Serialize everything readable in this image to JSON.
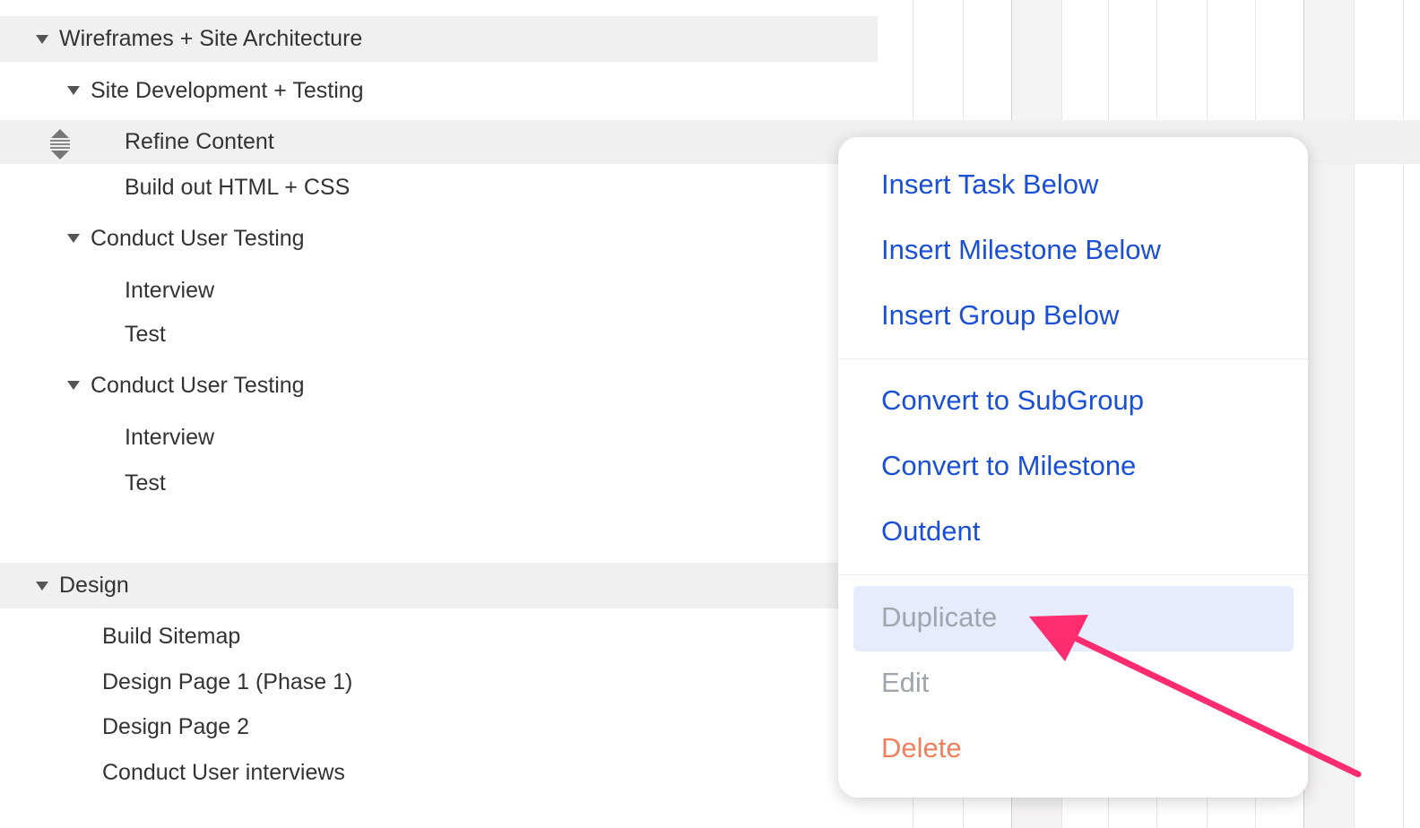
{
  "outline": {
    "rows": [
      {
        "label": "Wireframes + Site Architecture",
        "type": "group"
      },
      {
        "label": "Site Development + Testing",
        "type": "subgroup"
      },
      {
        "label": "Refine Content",
        "type": "task"
      },
      {
        "label": "Build out HTML + CSS",
        "type": "task"
      },
      {
        "label": "Conduct User Testing",
        "type": "subgroup"
      },
      {
        "label": "Interview",
        "type": "task"
      },
      {
        "label": "Test",
        "type": "task"
      },
      {
        "label": "Conduct User Testing",
        "type": "subgroup"
      },
      {
        "label": "Interview",
        "type": "task"
      },
      {
        "label": "Test",
        "type": "task"
      },
      {
        "label": "Design",
        "type": "group"
      },
      {
        "label": "Build Sitemap",
        "type": "task"
      },
      {
        "label": "Design Page 1 (Phase 1)",
        "type": "task"
      },
      {
        "label": "Design Page 2",
        "type": "task"
      },
      {
        "label": "Conduct User interviews",
        "type": "task"
      }
    ]
  },
  "context_menu": {
    "insert_task": "Insert Task Below",
    "insert_milestone": "Insert Milestone Below",
    "insert_group": "Insert Group Below",
    "convert_subgroup": "Convert to SubGroup",
    "convert_milestone": "Convert to Milestone",
    "outdent": "Outdent",
    "duplicate": "Duplicate",
    "edit": "Edit",
    "delete": "Delete"
  },
  "colors": {
    "link": "#1a4fd6",
    "disabled": "#a0a4ab",
    "danger": "#f07f5e",
    "arrow": "#ff2d6f"
  }
}
